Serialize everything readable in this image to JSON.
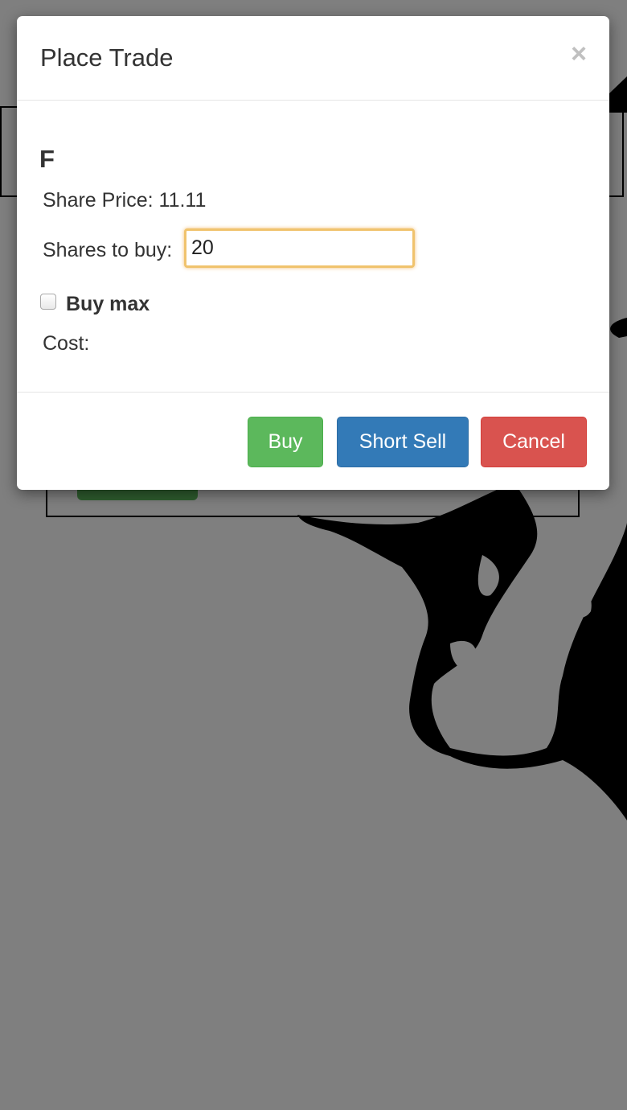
{
  "modal": {
    "title": "Place Trade",
    "close_label": "×"
  },
  "trade": {
    "symbol": "F",
    "share_price_label": "Share Price:",
    "share_price_value": "11.11",
    "shares_label": "Shares to buy:",
    "shares_value": "20",
    "buy_max_label": "Buy max",
    "buy_max_checked": false,
    "cost_label": "Cost:"
  },
  "buttons": {
    "buy": "Buy",
    "short_sell": "Short Sell",
    "cancel": "Cancel"
  },
  "colors": {
    "buy": "#5cb85c",
    "short_sell": "#337ab7",
    "cancel": "#d9534f",
    "input_focus": "#f0c36d",
    "backdrop": "rgba(0,0,0,0.5)"
  }
}
